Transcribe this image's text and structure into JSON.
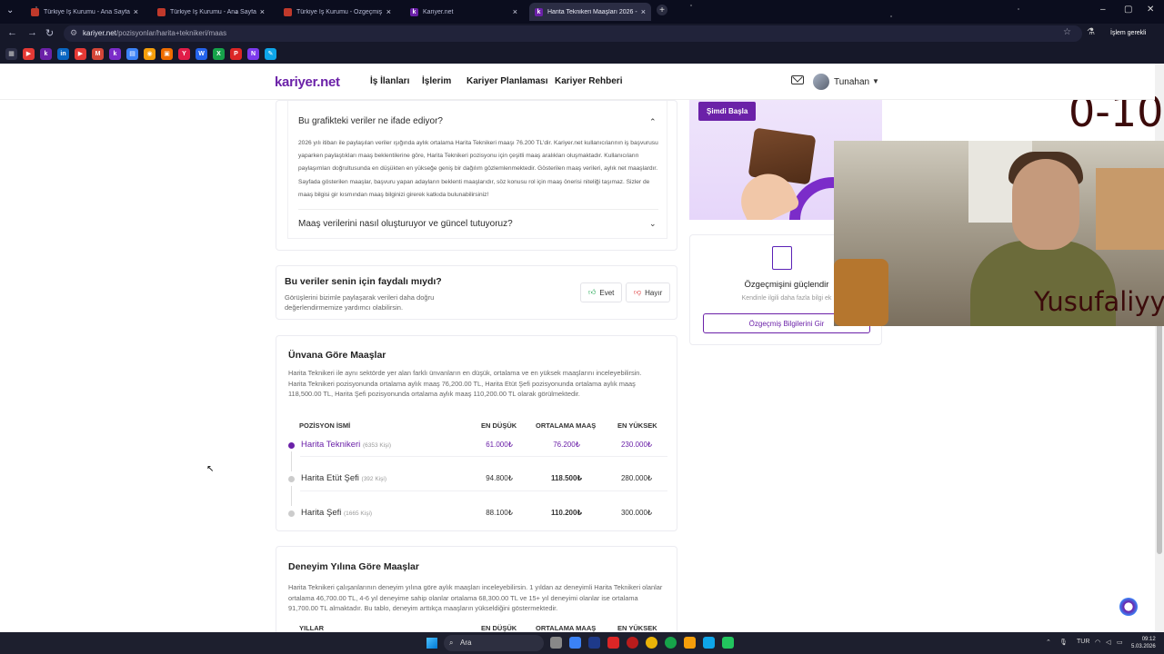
{
  "browser": {
    "tabs": [
      {
        "title": "Türkiye İş Kurumu - Ana Sayfa",
        "favicon": "isgkur-icon",
        "active": false
      },
      {
        "title": "Türkiye İş Kurumu - Ana Sayfa",
        "favicon": "isgkur-icon",
        "active": false
      },
      {
        "title": "Türkiye İş Kurumu - Özgeçmiş Görünt",
        "favicon": "isgkur-icon",
        "active": false
      },
      {
        "title": "Kariyer.net",
        "favicon": "kariyer-icon",
        "active": false
      },
      {
        "title": "Harita Teknikeri Maaşları 2026 - Orta",
        "favicon": "kariyer-icon",
        "active": true
      }
    ],
    "url_host": "kariyer.net",
    "url_path": "/pozisyonlar/harita+teknikeri/maas",
    "profile_button": "İşlem gerekli"
  },
  "site": {
    "logo": "kariyer.net",
    "nav": [
      "İş İlanları",
      "İşlerim",
      "Kariyer Planlaması",
      "Kariyer Rehberi"
    ],
    "user_name": "Tunahan"
  },
  "faq": {
    "q1": "Bu grafikteki veriler ne ifade ediyor?",
    "a1": "2026 yılı itibarı ile paylaşılan veriler ışığında aylık ortalama Harita Teknikeri maaşı 76.200 TL'dir. Kariyer.net kullanıcılarının iş başvurusu yaparken paylaştıkları maaş beklentilerine göre, Harita Teknikeri pozisyonu için çeşitli maaş aralıkları oluşmaktadır. Kullanıcıların paylaşımları doğrultusunda en düşükten en yükseğe geniş bir dağılım gözlemlenmektedir. Gösterilen maaş verileri, aylık net maaşlardır. Sayfada gösterilen maaşlar, başvuru yapan adayların beklenti maaşlarıdır, söz konusu rol için maaş önerisi niteliği taşımaz. Sizler de maaş bilgisi gir kısmından maaş bilginizi girerek katkıda bulunabilirsiniz!",
    "q2": "Maaş verilerini nasıl oluşturuyor ve güncel tutuyoruz?"
  },
  "feedback": {
    "title": "Bu veriler senin için faydalı mıydı?",
    "desc": "Görüşlerini bizimle paylaşarak verileri daha doğru değerlendirmemize yardımcı olabilirsin.",
    "yes": "Evet",
    "no": "Hayır"
  },
  "title_salaries": {
    "title": "Ünvana Göre Maaşlar",
    "desc": "Harita Teknikeri ile aynı sektörde yer alan farklı ünvanların en düşük, ortalama ve en yüksek maaşlarını inceleyebilirsin. Harita Teknikeri pozisyonunda ortalama aylık maaş 76,200.00 TL, Harita Etüt Şefi pozisyonunda ortalama aylık maaş 118,500.00 TL, Harita Şefi pozisyonunda ortalama aylık maaş 110,200.00 TL olarak görülmektedir.",
    "headers": [
      "POZİSYON İSMİ",
      "EN DÜŞÜK",
      "ORTALAMA MAAŞ",
      "EN YÜKSEK"
    ],
    "rows": [
      {
        "name": "Harita Teknikeri",
        "count": "(6353 Kişi)",
        "min": "61.000₺",
        "avg": "76.200₺",
        "max": "230.000₺",
        "highlight": true
      },
      {
        "name": "Harita Etüt Şefi",
        "count": "(392 Kişi)",
        "min": "94.800₺",
        "avg": "118.500₺",
        "max": "280.000₺",
        "highlight": false
      },
      {
        "name": "Harita Şefi",
        "count": "(1665 Kişi)",
        "min": "88.100₺",
        "avg": "110.200₺",
        "max": "300.000₺",
        "highlight": false
      }
    ]
  },
  "experience": {
    "title": "Deneyim Yılına Göre Maaşlar",
    "desc": "Harita Teknikeri çalışanlarının deneyim yılına göre aylık maaşları inceleyebilirsin. 1 yıldan az deneyimli Harita Teknikeri olanlar ortalama 46,700.00 TL, 4-6 yıl deneyime sahip olanlar ortalama 68,300.00 TL ve 15+ yıl deneyimi olanlar ise ortalama 91,700.00 TL almaktadır. Bu tablo, deneyim arttıkça maaşların yükseldiğini göstermektedir.",
    "headers": [
      "YILLAR",
      "EN DÜŞÜK",
      "ORTALAMA MAAŞ",
      "EN YÜKSEK"
    ]
  },
  "sidebar": {
    "ad_button": "Şimdi Başla",
    "cv_title": "Özgeçmişini güçlendir",
    "cv_sub": "Kendinle ilgili daha fazla bilgi ek",
    "cv_button": "Özgeçmiş Bilgilerini Gir"
  },
  "overlay": {
    "big_text": "0-10",
    "cam_name": "Yusufaliyy"
  },
  "taskbar": {
    "search": "Ara",
    "lang": "TUR",
    "time": "09:12",
    "date": "5.03.2026"
  },
  "colors": {
    "brand": "#6b21a8",
    "highlight_row": "#6b21a8"
  }
}
